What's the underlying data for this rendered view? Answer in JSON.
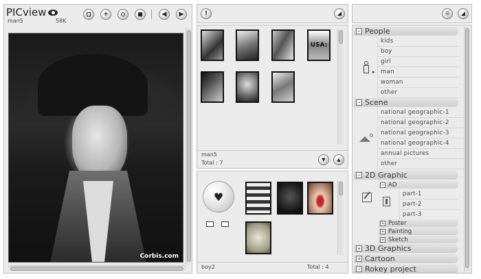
{
  "app": {
    "logo": "PICview",
    "file_name": "man5",
    "file_size": "58K"
  },
  "viewer": {
    "watermark": "Corbis.com"
  },
  "folder1": {
    "name": "man5",
    "total": "Total : 7"
  },
  "folder2": {
    "name": "boy2",
    "total": "Total : 4"
  },
  "categories": {
    "people": {
      "label": "People",
      "items": [
        "kids",
        "boy",
        "girl",
        "man",
        "woman",
        "other"
      ]
    },
    "scene": {
      "label": "Scene",
      "items": [
        "national geographic-1",
        "national geographic-2",
        "national geographic-3",
        "national geographic-4",
        "annual pictures",
        "other"
      ]
    },
    "graphic2d": {
      "label": "2D Graphic",
      "ad": {
        "label": "AD",
        "items": [
          "part-1",
          "part-2",
          "part-3"
        ]
      },
      "poster": "Poster",
      "painting": "Painting",
      "sketch": "Sketch"
    },
    "graphics3d": "3D Graphics",
    "cartoon": "Cartoon",
    "rokey": "Rokey project"
  }
}
